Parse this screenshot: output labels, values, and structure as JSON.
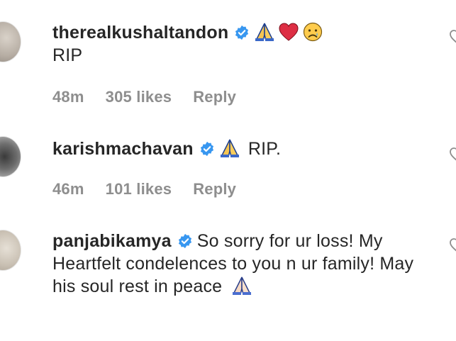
{
  "comments": [
    {
      "username": "therealkushaltandon",
      "text": "RIP",
      "emojis": [
        "folded-hands-icon",
        "red-heart-icon",
        "sad-face-icon"
      ],
      "time": "48m",
      "likes": "305 likes",
      "reply": "Reply"
    },
    {
      "username": "karishmachavan",
      "text": "RIP.",
      "emojis": [
        "folded-hands-icon"
      ],
      "time": "46m",
      "likes": "101 likes",
      "reply": "Reply"
    },
    {
      "username": "panjabikamya",
      "text": "So sorry for ur loss! My Heartfelt condelences to you n ur family! May his soul rest in peace",
      "emojis": [
        "folded-hands-icon"
      ]
    }
  ],
  "colors": {
    "text": "#262626",
    "meta": "#8e8e8e",
    "verified": "#3897f0",
    "heart": "#ed4956"
  }
}
